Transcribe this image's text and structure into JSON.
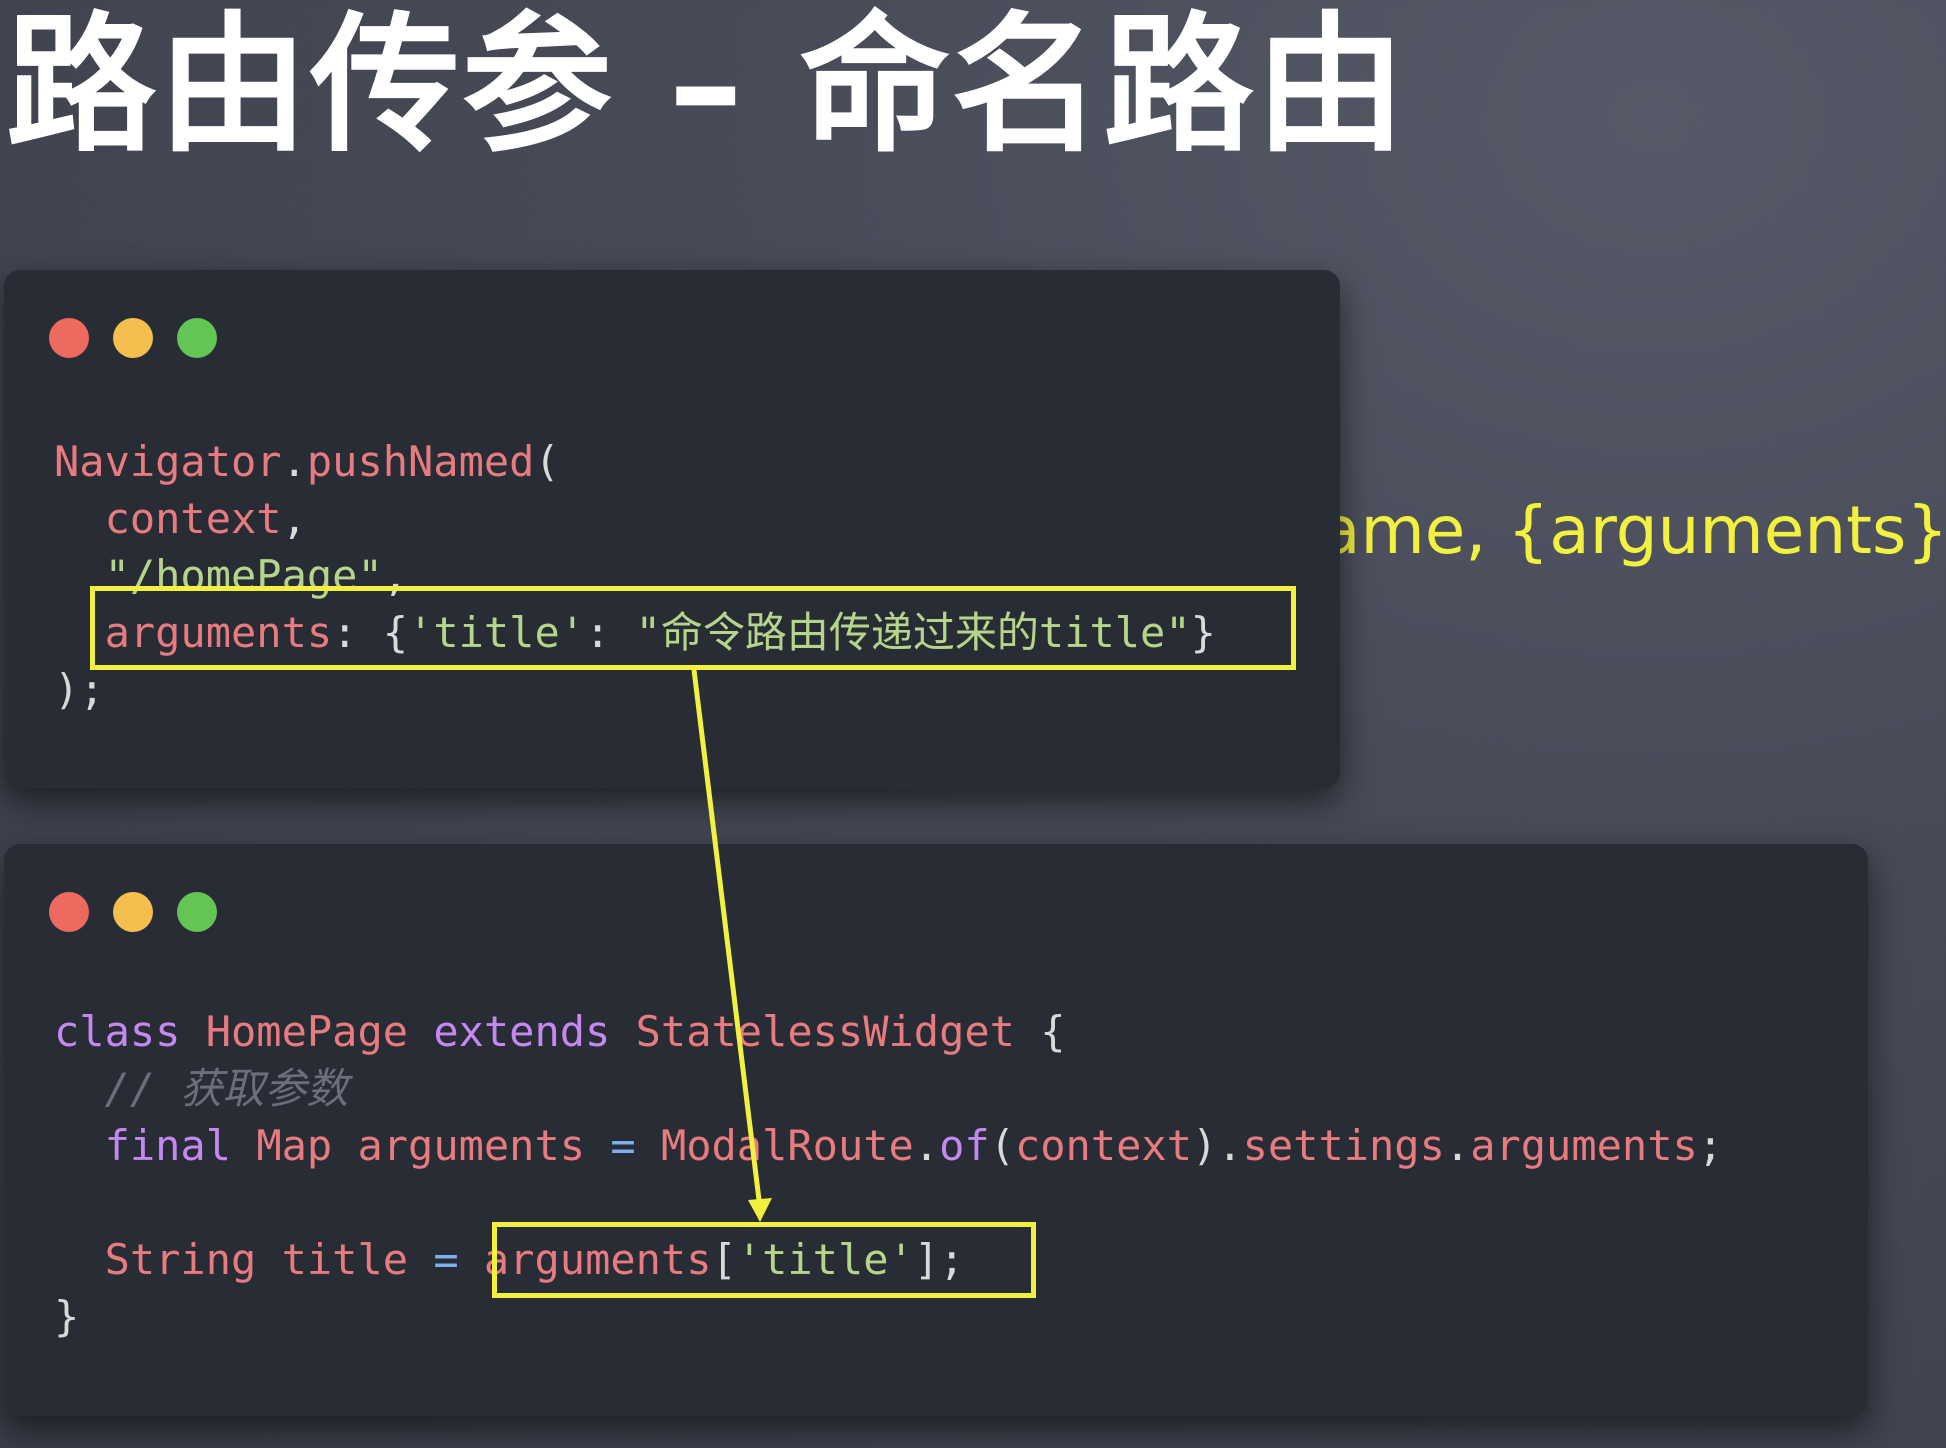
{
  "slide": {
    "title": "路由传参 – 命名路由",
    "background_snippet": "ame, {arguments})"
  },
  "colors": {
    "highlight": "#f3f140",
    "window_bg": "#282c35",
    "dot_red": "#ed6a5e",
    "dot_yellow": "#f5bf4f",
    "dot_green": "#62c554"
  },
  "code_window_1": {
    "tokens": {
      "navigator": "Navigator",
      "dot1": ".",
      "push_named": "pushNamed",
      "open_paren": "(",
      "context": "context",
      "comma1": ",",
      "route": "\"/homePage\"",
      "comma2": ",",
      "arguments_key": "arguments",
      "colon": ": ",
      "brace_open": "{",
      "title_key": "'title'",
      "colon2": ": ",
      "title_value": "\"命令路由传递过来的title\"",
      "brace_close": "}",
      "close": ");"
    }
  },
  "code_window_2": {
    "tokens": {
      "kw_class": "class",
      "class_name": "HomePage",
      "kw_extends": "extends",
      "super_name": "StatelessWidget",
      "open_brace": "{",
      "comment": "// 获取参数",
      "kw_final": "final",
      "type_map": "Map",
      "var_arguments": "arguments",
      "eq1": "=",
      "modal_route": "ModalRoute",
      "dot_of": ".",
      "of": "of",
      "paren_open": "(",
      "ctx": "context",
      "paren_close": ")",
      "dot_settings": ".",
      "settings": "settings",
      "dot_args": ".",
      "args_prop": "arguments",
      "semi1": ";",
      "type_string": "String",
      "var_title": "title",
      "eq2": "=",
      "args_ref": "arguments",
      "bracket_open": "[",
      "key_title": "'title'",
      "bracket_close": "]",
      "semi2": ";",
      "close_brace": "}"
    }
  }
}
